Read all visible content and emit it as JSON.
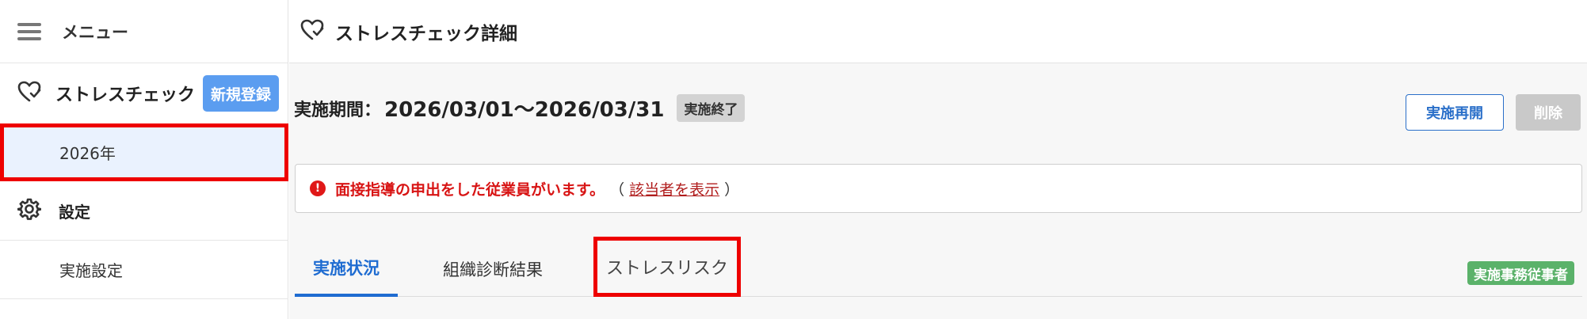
{
  "sidebar": {
    "menu_label": "メニュー",
    "stress_check_label": "ストレスチェック",
    "new_button_label": "新規登録",
    "year_item_label": "2026年",
    "settings_label": "設定",
    "impl_settings_label": "実施設定"
  },
  "header": {
    "title": "ストレスチェック詳細"
  },
  "period": {
    "label": "実施期間：",
    "value": "2026/03/01〜2026/03/31",
    "status": "実施終了"
  },
  "actions": {
    "resume_label": "実施再開",
    "delete_label": "削除"
  },
  "alert": {
    "icon": "!",
    "message": "面接指導の申出をした従業員がいます。",
    "paren_open": "（",
    "link_label": "該当者を表示",
    "paren_close": "）"
  },
  "tabs": [
    {
      "label": "実施状況",
      "active": true
    },
    {
      "label": "組織診断結果",
      "active": false
    },
    {
      "label": "ストレスリスク",
      "active": false
    }
  ],
  "role_badge": "実施事務従事者",
  "colors": {
    "accent": "#1f6cd1",
    "new_button": "#5b9df0",
    "alert_red": "#d81414",
    "role_green": "#5bb26a",
    "highlight_box": "#ee0000"
  }
}
